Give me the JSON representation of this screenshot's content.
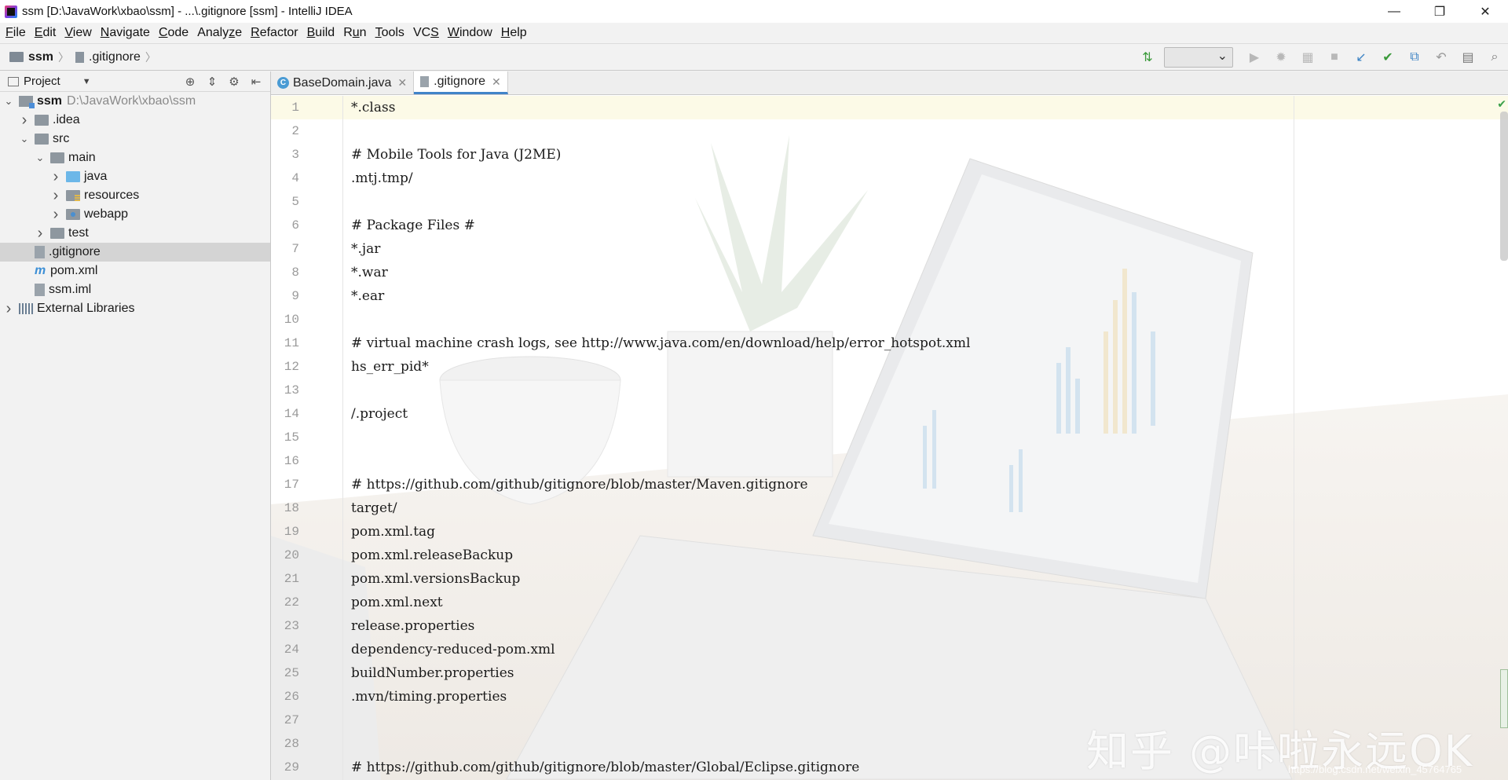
{
  "window": {
    "title": "ssm [D:\\JavaWork\\xbao\\ssm] - ...\\.gitignore [ssm] - IntelliJ IDEA",
    "controls": {
      "minimize": "—",
      "restore": "❐",
      "close": "✕"
    }
  },
  "menu": [
    {
      "pre": "",
      "mn": "F",
      "post": "ile"
    },
    {
      "pre": "",
      "mn": "E",
      "post": "dit"
    },
    {
      "pre": "",
      "mn": "V",
      "post": "iew"
    },
    {
      "pre": "",
      "mn": "N",
      "post": "avigate"
    },
    {
      "pre": "",
      "mn": "C",
      "post": "ode"
    },
    {
      "pre": "Analy",
      "mn": "z",
      "post": "e"
    },
    {
      "pre": "",
      "mn": "R",
      "post": "efactor"
    },
    {
      "pre": "",
      "mn": "B",
      "post": "uild"
    },
    {
      "pre": "R",
      "mn": "u",
      "post": "n"
    },
    {
      "pre": "",
      "mn": "T",
      "post": "ools"
    },
    {
      "pre": "VC",
      "mn": "S",
      "post": ""
    },
    {
      "pre": "",
      "mn": "W",
      "post": "indow"
    },
    {
      "pre": "",
      "mn": "H",
      "post": "elp"
    }
  ],
  "breadcrumb": {
    "project": "ssm",
    "file": ".gitignore"
  },
  "project_panel": {
    "title": "Project",
    "tree": [
      {
        "indent": 0,
        "arrow": "down",
        "icon": "module",
        "label": "ssm",
        "bold": true,
        "sub": "D:\\JavaWork\\xbao\\ssm"
      },
      {
        "indent": 1,
        "arrow": "right",
        "icon": "folder",
        "label": ".idea"
      },
      {
        "indent": 1,
        "arrow": "down",
        "icon": "folder",
        "label": "src"
      },
      {
        "indent": 2,
        "arrow": "down",
        "icon": "folder",
        "label": "main"
      },
      {
        "indent": 3,
        "arrow": "right",
        "icon": "folder-blue",
        "label": "java"
      },
      {
        "indent": 3,
        "arrow": "right",
        "icon": "folder-res",
        "label": "resources"
      },
      {
        "indent": 3,
        "arrow": "right",
        "icon": "folder-web",
        "label": "webapp"
      },
      {
        "indent": 2,
        "arrow": "right",
        "icon": "folder",
        "label": "test"
      },
      {
        "indent": 1,
        "arrow": "none",
        "icon": "file",
        "label": ".gitignore",
        "selected": true
      },
      {
        "indent": 1,
        "arrow": "none",
        "icon": "maven",
        "label": "pom.xml"
      },
      {
        "indent": 1,
        "arrow": "none",
        "icon": "file",
        "label": "ssm.iml"
      },
      {
        "indent": 0,
        "arrow": "right",
        "icon": "libs",
        "label": "External Libraries"
      }
    ]
  },
  "tabs": [
    {
      "label": "BaseDomain.java",
      "icon": "class",
      "active": false
    },
    {
      "label": ".gitignore",
      "icon": "file",
      "active": true
    }
  ],
  "editor_lines": [
    "*.class",
    "",
    "# Mobile Tools for Java (J2ME)",
    ".mtj.tmp/",
    "",
    "# Package Files #",
    "*.jar",
    "*.war",
    "*.ear",
    "",
    "# virtual machine crash logs, see http://www.java.com/en/download/help/error_hotspot.xml",
    "hs_err_pid*",
    "",
    "/.project",
    "",
    "",
    "# https://github.com/github/gitignore/blob/master/Maven.gitignore",
    "target/",
    "pom.xml.tag",
    "pom.xml.releaseBackup",
    "pom.xml.versionsBackup",
    "pom.xml.next",
    "release.properties",
    "dependency-reduced-pom.xml",
    "buildNumber.properties",
    ".mvn/timing.properties",
    "",
    "",
    "# https://github.com/github/gitignore/blob/master/Global/Eclipse.gitignore"
  ],
  "watermark": "知乎 @咔啦永远OK",
  "csdn_watermark": "https://blog.csdn.net/weixin_45764765"
}
